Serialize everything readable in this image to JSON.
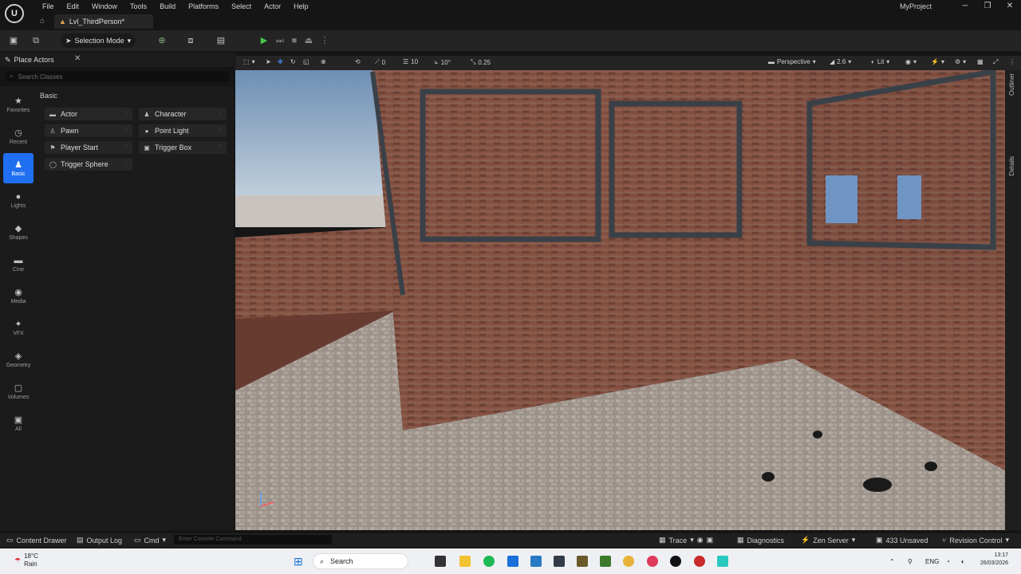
{
  "app": {
    "project_name": "MyProject",
    "level_tab": "Lvl_ThirdPerson*",
    "logo_text": "U"
  },
  "menu": [
    "File",
    "Edit",
    "Window",
    "Tools",
    "Build",
    "Platforms",
    "Select",
    "Actor",
    "Help"
  ],
  "window_controls": {
    "minimize": "─",
    "maximize": "❐",
    "close": "✕"
  },
  "toolbar": {
    "mode_label": "Selection Mode",
    "save_icon": "save-icon",
    "play_icon": "play-icon"
  },
  "place_actors": {
    "title": "Place Actors",
    "search_placeholder": "Search Classes",
    "section_label": "Basic",
    "categories": [
      {
        "label": "Favorites",
        "icon": "★",
        "active": false
      },
      {
        "label": "Recent",
        "icon": "◷",
        "active": false
      },
      {
        "label": "Basic",
        "icon": "♟",
        "active": true
      },
      {
        "label": "Lights",
        "icon": "●",
        "active": false
      },
      {
        "label": "Shapes",
        "icon": "◆",
        "active": false
      },
      {
        "label": "Cine",
        "icon": "▬",
        "active": false
      },
      {
        "label": "Media",
        "icon": "◉",
        "active": false
      },
      {
        "label": "VFX",
        "icon": "✦",
        "active": false
      },
      {
        "label": "Geometry",
        "icon": "◈",
        "active": false
      },
      {
        "label": "Volumes",
        "icon": "▢",
        "active": false
      },
      {
        "label": "All",
        "icon": "▣",
        "active": false
      }
    ],
    "actors": [
      {
        "label": "Actor",
        "icon": "▬"
      },
      {
        "label": "Character",
        "icon": "♟"
      },
      {
        "label": "Pawn",
        "icon": "♙"
      },
      {
        "label": "Point Light",
        "icon": "●"
      },
      {
        "label": "Player Start",
        "icon": "⚑"
      },
      {
        "label": "Trigger Box",
        "icon": "▣"
      },
      {
        "label": "Trigger Sphere",
        "icon": "◯"
      }
    ]
  },
  "viewport": {
    "grid_snap": "0",
    "translate_snap": "10",
    "rotate_snap": "10°",
    "scale_snap": "0.25",
    "view_mode": "Perspective",
    "camera_speed": "2.6",
    "lighting_mode": "Lit"
  },
  "side_tabs": {
    "outliner": "Outliner",
    "details": "Details"
  },
  "statusbar": {
    "content_drawer": "Content Drawer",
    "output_log": "Output Log",
    "cmd": "Cmd",
    "console_placeholder": "Enter Console Command",
    "trace": "Trace",
    "diagnostics": "Diagnostics",
    "zen_server": "Zen Server",
    "unsaved": "433 Unsaved",
    "revision_control": "Revision Control"
  },
  "taskbar": {
    "temperature": "18°C",
    "weather": "Rain",
    "search_label": "Search",
    "language": "ENG",
    "time": "13:17",
    "date": "26/03/2026"
  }
}
